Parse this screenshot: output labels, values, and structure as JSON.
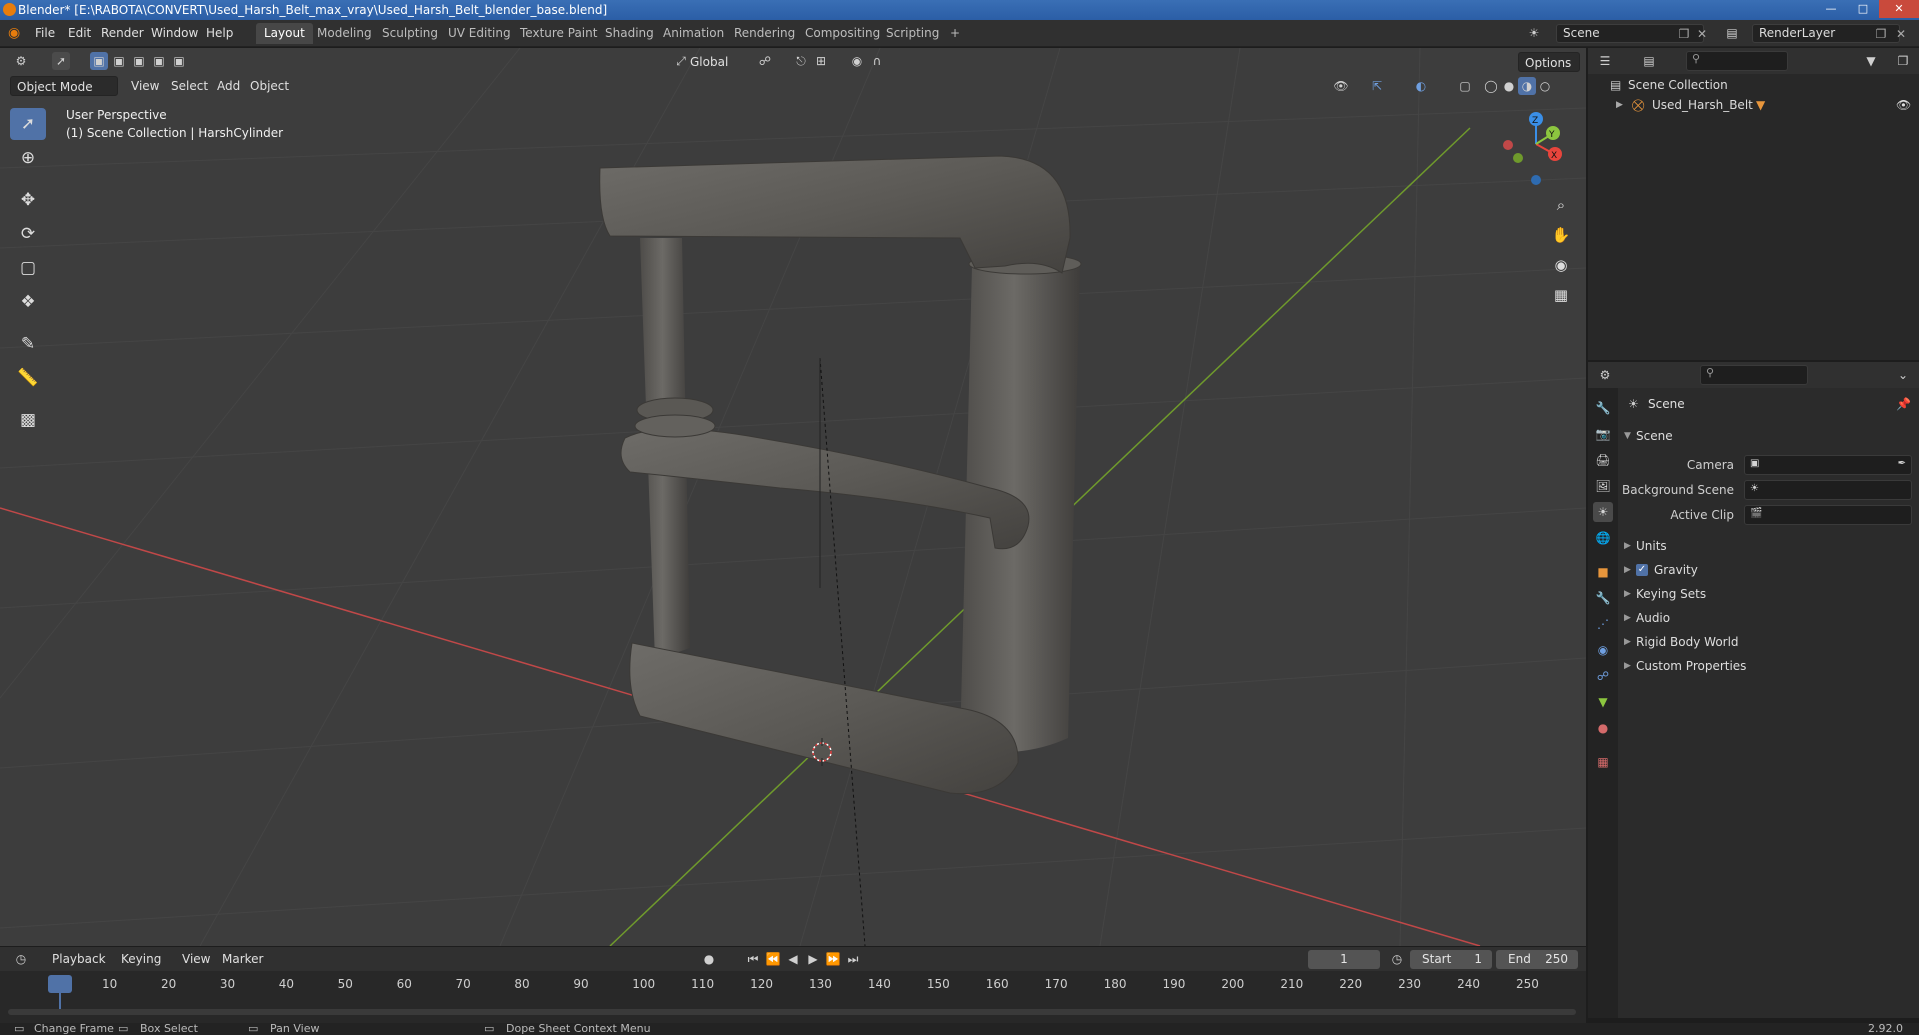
{
  "window": {
    "title": "Blender* [E:\\RABOTA\\CONVERT\\Used_Harsh_Belt_max_vray\\Used_Harsh_Belt_blender_base.blend]"
  },
  "menu": [
    "File",
    "Edit",
    "Render",
    "Window",
    "Help"
  ],
  "workspaces": [
    "Layout",
    "Modeling",
    "Sculpting",
    "UV Editing",
    "Texture Paint",
    "Shading",
    "Animation",
    "Rendering",
    "Compositing",
    "Scripting"
  ],
  "active_workspace": "Layout",
  "scene_name": "Scene",
  "render_layer": "RenderLayer",
  "viewport": {
    "mode": "Object Mode",
    "menus": [
      "View",
      "Select",
      "Add",
      "Object"
    ],
    "transform_orientation": "Global",
    "options_label": "Options",
    "perspective_label": "User Perspective",
    "collection_label": "(1) Scene Collection | HarshCylinder",
    "gizmo_axes": {
      "x": "X",
      "y": "Y",
      "z": "Z"
    },
    "axis_colors": {
      "x": "#e8453c",
      "y": "#8cc63f",
      "z": "#3a8fe8",
      "grid_x_line": "#c04848",
      "grid_y_line": "#6f9a2c"
    }
  },
  "outliner": {
    "root": "Scene Collection",
    "items": [
      {
        "label": "Used_Harsh_Belt"
      }
    ]
  },
  "properties": {
    "context": "Scene",
    "section": "Scene",
    "fields": [
      {
        "label": "Camera"
      },
      {
        "label": "Background Scene"
      },
      {
        "label": "Active Clip"
      }
    ],
    "panels": [
      "Units",
      "Gravity",
      "Keying Sets",
      "Audio",
      "Rigid Body World",
      "Custom Properties"
    ],
    "gravity_checked": true
  },
  "timeline": {
    "menus": [
      "Playback",
      "Keying",
      "View",
      "Marker"
    ],
    "current_frame": "1",
    "start_label": "Start",
    "start": "1",
    "end_label": "End",
    "end": "250",
    "ticks": [
      "1",
      "10",
      "20",
      "30",
      "40",
      "50",
      "60",
      "70",
      "80",
      "90",
      "100",
      "110",
      "120",
      "130",
      "140",
      "150",
      "160",
      "170",
      "180",
      "190",
      "200",
      "210",
      "220",
      "230",
      "240",
      "250"
    ]
  },
  "status": {
    "items": [
      "Change Frame",
      "Box Select",
      "Pan View",
      "Dope Sheet Context Menu"
    ],
    "version": "2.92.0"
  },
  "colors": {
    "accent": "#5072a7",
    "active_tab": "#474747",
    "brand_orange": "#e87d0d"
  }
}
